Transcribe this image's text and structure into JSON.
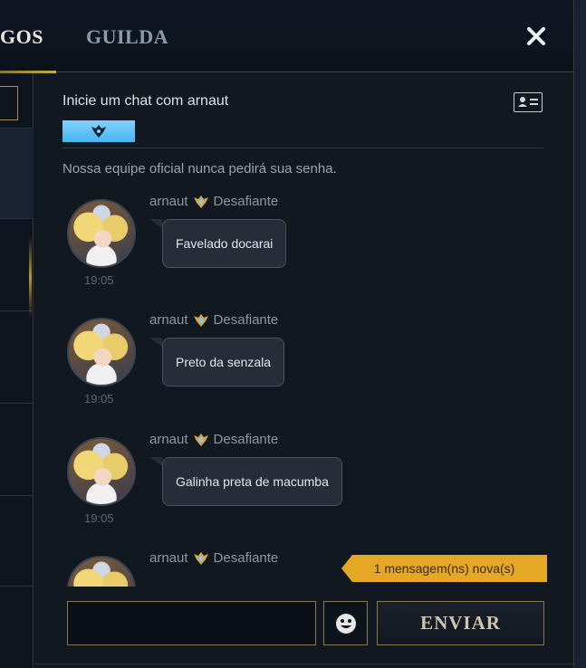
{
  "header": {
    "tab_friends": "GOS",
    "tab_guild": "GUILDA",
    "close_icon": "close-icon"
  },
  "chat": {
    "start_label": "Inicie um chat com arnaut",
    "warning": "Nossa equipe oficial nunca pedirá sua senha.",
    "messages": [
      {
        "sender": "arnaut",
        "rank": "Desafiante",
        "text": "Favelado docarai",
        "time": "19:05"
      },
      {
        "sender": "arnaut",
        "rank": "Desafiante",
        "text": "Preto da senzala",
        "time": "19:05"
      },
      {
        "sender": "arnaut",
        "rank": "Desafiante",
        "text": "Galinha preta de macumba",
        "time": "19:05"
      },
      {
        "sender": "arnaut",
        "rank": "Desafiante",
        "text": "",
        "time": ""
      }
    ],
    "new_messages_badge": "1 mensagem(ns) nova(s)"
  },
  "composer": {
    "input_value": "",
    "input_placeholder": "",
    "send_label": "ENVIAR"
  },
  "colors": {
    "accent_gold": "#c9a64c",
    "badge_yellow": "#e5a824",
    "rank_tag_blue": "#49b4ee"
  }
}
